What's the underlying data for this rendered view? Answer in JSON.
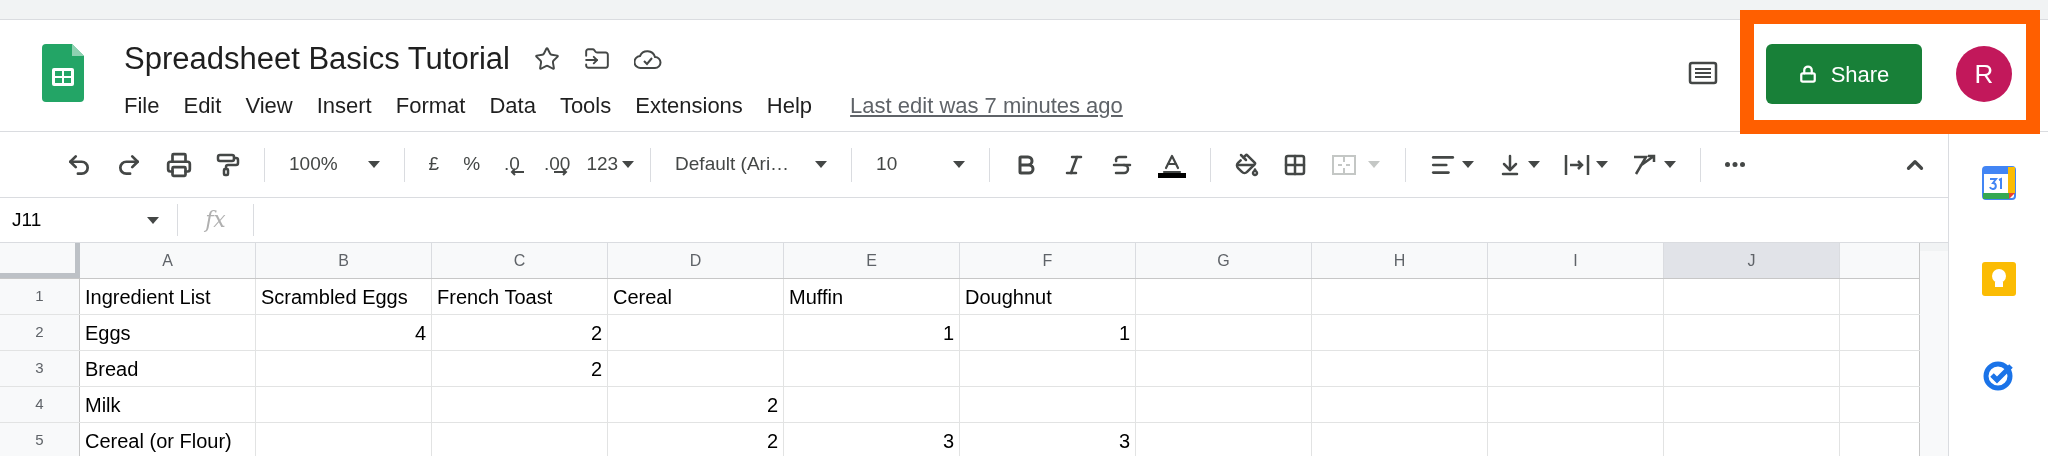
{
  "document": {
    "title": "Spreadsheet Basics Tutorial",
    "menu": [
      "File",
      "Edit",
      "View",
      "Insert",
      "Format",
      "Data",
      "Tools",
      "Extensions",
      "Help"
    ],
    "last_edit": "Last edit was 7 minutes ago",
    "share": "Share",
    "avatar": "R"
  },
  "toolbar": {
    "zoom": "100%",
    "currency": "£",
    "percent": "%",
    "decrease_decimal": ".0",
    "increase_decimal": ".00",
    "number_format": "123",
    "font": "Default (Ari…",
    "font_size": "10",
    "merge_disabled": true
  },
  "formula_bar": {
    "cell_ref": "J11",
    "fx": "fx"
  },
  "sheet": {
    "columns": [
      {
        "label": "A",
        "selected": false
      },
      {
        "label": "B",
        "selected": false
      },
      {
        "label": "C",
        "selected": false
      },
      {
        "label": "D",
        "selected": false
      },
      {
        "label": "E",
        "selected": false
      },
      {
        "label": "F",
        "selected": false
      },
      {
        "label": "G",
        "selected": false
      },
      {
        "label": "H",
        "selected": false
      },
      {
        "label": "I",
        "selected": false
      },
      {
        "label": "J",
        "selected": true
      }
    ],
    "rows": [
      {
        "label": "1",
        "cells": [
          {
            "text": "Ingredient List",
            "kind": "text"
          },
          {
            "text": "Scrambled Eggs",
            "kind": "text"
          },
          {
            "text": "French Toast",
            "kind": "text"
          },
          {
            "text": "Cereal",
            "kind": "text"
          },
          {
            "text": "Muffin",
            "kind": "text"
          },
          {
            "text": "Doughnut",
            "kind": "text"
          }
        ]
      },
      {
        "label": "2",
        "cells": [
          {
            "text": "Eggs",
            "kind": "text"
          },
          {
            "text": "4",
            "kind": "number"
          },
          {
            "text": "2",
            "kind": "number"
          },
          null,
          {
            "text": "1",
            "kind": "number"
          },
          {
            "text": "1",
            "kind": "number"
          }
        ]
      },
      {
        "label": "3",
        "cells": [
          {
            "text": "Bread",
            "kind": "text"
          },
          null,
          {
            "text": "2",
            "kind": "number"
          }
        ]
      },
      {
        "label": "4",
        "cells": [
          {
            "text": "Milk",
            "kind": "text"
          },
          null,
          null,
          {
            "text": "2",
            "kind": "number"
          }
        ]
      },
      {
        "label": "5",
        "cells": [
          {
            "text": "Cereal (or Flour)",
            "kind": "text"
          },
          null,
          null,
          {
            "text": "2",
            "kind": "number"
          },
          {
            "text": "3",
            "kind": "number"
          },
          {
            "text": "3",
            "kind": "number"
          }
        ]
      }
    ]
  }
}
